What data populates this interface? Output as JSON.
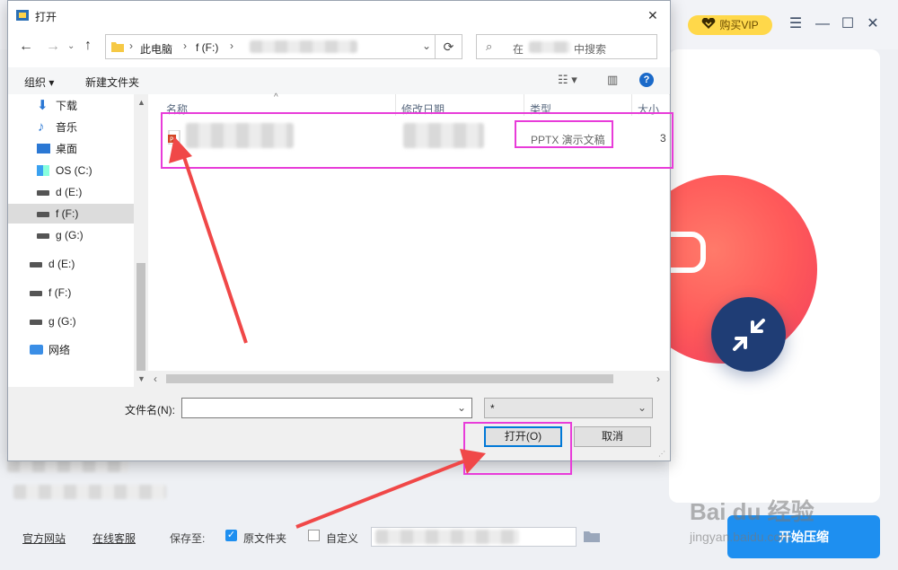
{
  "app": {
    "vip_label": "购买VIP",
    "footer": {
      "official_site": "官方网站",
      "online_service": "在线客服",
      "save_to_label": "保存至:",
      "original_folder": "原文件夹",
      "custom": "自定义",
      "start_button": "开始压缩"
    },
    "watermark": "Bai du 经验",
    "watermark_url": "jingyan.baidu.com"
  },
  "dialog": {
    "title": "打开",
    "close_symbol": "✕",
    "breadcrumb": [
      "此电脑",
      "f (F:)"
    ],
    "search_placeholder_prefix": "在",
    "search_placeholder_suffix": "中搜索",
    "toolbar": {
      "organize": "组织",
      "new_folder": "新建文件夹"
    },
    "nav_items": [
      {
        "label": "下载",
        "icon": "download-icon"
      },
      {
        "label": "音乐",
        "icon": "music-icon"
      },
      {
        "label": "桌面",
        "icon": "desktop-icon"
      },
      {
        "label": "OS (C:)",
        "icon": "os-drive-icon"
      },
      {
        "label": "d (E:)",
        "icon": "drive-icon"
      },
      {
        "label": "f (F:)",
        "icon": "drive-icon",
        "selected": true
      },
      {
        "label": "g (G:)",
        "icon": "drive-icon"
      },
      {
        "label": "d (E:)",
        "icon": "drive-icon"
      },
      {
        "label": "f (F:)",
        "icon": "drive-icon"
      },
      {
        "label": "g (G:)",
        "icon": "drive-icon"
      },
      {
        "label": "网络",
        "icon": "network-icon"
      }
    ],
    "columns": {
      "name": "名称",
      "date": "修改日期",
      "type": "类型",
      "size": "大小"
    },
    "file": {
      "type": "PPTX 演示文稿",
      "size": "3"
    },
    "filename_label": "文件名(N):",
    "filter_value": "*",
    "open_button": "打开(O)",
    "cancel_button": "取消"
  },
  "colors": {
    "highlight": "#e83cd9",
    "arrow": "#f04848",
    "accent_blue": "#1e8ff0",
    "vip_yellow": "#ffd84a"
  }
}
